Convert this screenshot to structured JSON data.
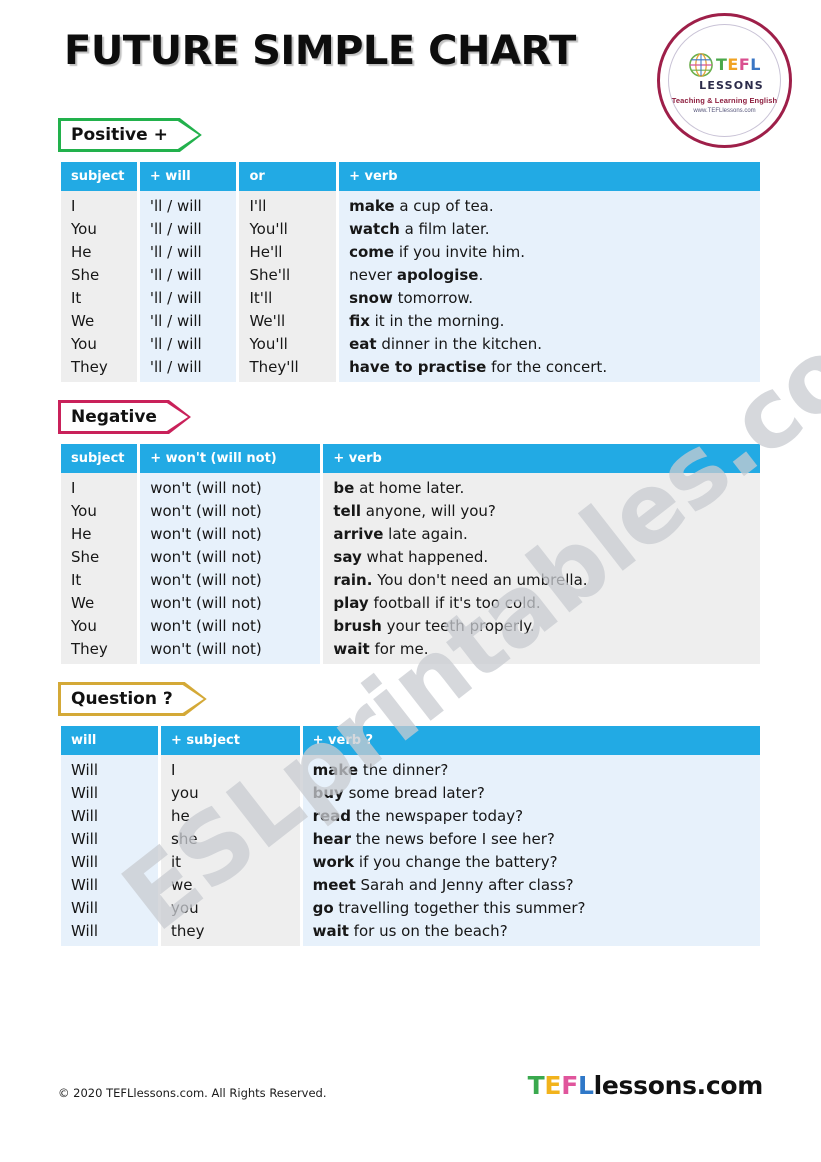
{
  "page": {
    "title": "FUTURE SIMPLE CHART",
    "watermark": "ESLprintables.com"
  },
  "logo": {
    "icon": "globe-icon",
    "tefl_t": "T",
    "tefl_e": "E",
    "tefl_f": "F",
    "tefl_l": "L",
    "lessons": "LESSONS",
    "tagline": "Teaching  & Learning English",
    "url": "www.TEFLlessons.com"
  },
  "colors": {
    "header_blue": "#22aae4",
    "cell_gray": "#eeeeee",
    "cell_blue": "#e7f1fb",
    "positive_green": "#22b14c",
    "negative_crimson": "#c9215a",
    "question_gold": "#d4a937",
    "logo_ring": "#9e1f49"
  },
  "sections": [
    {
      "id": "positive",
      "badge": "Positive +",
      "badge_color": "#22b14c",
      "headers": [
        "subject",
        "+ will",
        "or",
        "+ verb"
      ],
      "col_styles": [
        "c-gray",
        "c-blue",
        "c-gray",
        "c-blue"
      ],
      "col_widths": [
        "11%",
        "14%",
        "14%",
        "61%"
      ],
      "rows": [
        {
          "subject": "I",
          "will": "'ll / will",
          "or": "I'll",
          "verb_bold": "make",
          "verb_rest": " a cup of tea."
        },
        {
          "subject": "You",
          "will": "'ll / will",
          "or": "You'll",
          "verb_bold": "watch",
          "verb_rest": " a film later."
        },
        {
          "subject": "He",
          "will": "'ll / will",
          "or": "He'll",
          "verb_bold": "come",
          "verb_rest": " if you invite him."
        },
        {
          "subject": "She",
          "will": "'ll / will",
          "or": "She'll",
          "verb_pre": "never ",
          "verb_bold": "apologise",
          "verb_rest": "."
        },
        {
          "subject": "It",
          "will": "'ll / will",
          "or": "It'll",
          "verb_bold": "snow",
          "verb_rest": " tomorrow."
        },
        {
          "subject": "We",
          "will": "'ll / will",
          "or": "We'll",
          "verb_bold": "fix",
          "verb_rest": " it in the morning."
        },
        {
          "subject": "You",
          "will": "'ll / will",
          "or": "You'll",
          "verb_bold": "eat",
          "verb_rest": " dinner in the kitchen."
        },
        {
          "subject": "They",
          "will": "'ll / will",
          "or": "They'll",
          "verb_bold": "have to practise",
          "verb_rest": " for the concert."
        }
      ]
    },
    {
      "id": "negative",
      "badge": "Negative",
      "badge_color": "#c9215a",
      "headers": [
        "subject",
        "+ won't  (will not)",
        "+ verb"
      ],
      "col_styles": [
        "c-gray",
        "c-blue",
        "c-gray"
      ],
      "col_widths": [
        "11%",
        "26%",
        "63%"
      ],
      "rows": [
        {
          "subject": "I",
          "will": "won't  (will not)",
          "verb_bold": "be",
          "verb_rest": " at home later."
        },
        {
          "subject": "You",
          "will": "won't  (will not)",
          "verb_bold": "tell",
          "verb_rest": " anyone, will you?"
        },
        {
          "subject": "He",
          "will": "won't  (will not)",
          "verb_bold": "arrive",
          "verb_rest": " late again."
        },
        {
          "subject": "She",
          "will": "won't  (will not)",
          "verb_bold": "say",
          "verb_rest": " what happened."
        },
        {
          "subject": "It",
          "will": "won't  (will not)",
          "verb_bold": "rain.",
          "verb_rest": " You don't need an umbrella."
        },
        {
          "subject": "We",
          "will": "won't  (will not)",
          "verb_bold": "play",
          "verb_rest": " football if it's too cold."
        },
        {
          "subject": "You",
          "will": "won't  (will not)",
          "verb_bold": "brush",
          "verb_rest": " your teeth properly."
        },
        {
          "subject": "They",
          "will": "won't  (will not)",
          "verb_bold": "wait",
          "verb_rest": " for me."
        }
      ]
    },
    {
      "id": "question",
      "badge": "Question ?",
      "badge_color": "#d4a937",
      "headers": [
        "will",
        "+ subject",
        "+ verb ?"
      ],
      "col_styles": [
        "c-blue",
        "c-gray",
        "c-blue"
      ],
      "col_widths": [
        "14%",
        "20%",
        "66%"
      ],
      "rows": [
        {
          "subject": "Will",
          "will": "I",
          "verb_bold": "make",
          "verb_rest": " the dinner?"
        },
        {
          "subject": "Will",
          "will": "you",
          "verb_bold": "buy",
          "verb_rest": " some bread later?"
        },
        {
          "subject": "Will",
          "will": "he",
          "verb_bold": "read",
          "verb_rest": " the newspaper today?"
        },
        {
          "subject": "Will",
          "will": "she",
          "verb_bold": "hear",
          "verb_rest": " the news before I see her?"
        },
        {
          "subject": "Will",
          "will": "it",
          "verb_bold": "work",
          "verb_rest": " if you change the battery?"
        },
        {
          "subject": "Will",
          "will": "we",
          "verb_bold": "meet",
          "verb_rest": " Sarah and Jenny after class?"
        },
        {
          "subject": "Will",
          "will": "you",
          "verb_bold": "go",
          "verb_rest": " travelling together this summer?"
        },
        {
          "subject": "Will",
          "will": "they",
          "verb_bold": "wait",
          "verb_rest": " for us on the beach?"
        }
      ]
    }
  ],
  "footer": {
    "copyright": "© 2020 TEFLlessons.com. All Rights Reserved.",
    "logo_t": "T",
    "logo_e": "E",
    "logo_f": "F",
    "logo_l": "L",
    "logo_rest": "lessons.com"
  }
}
